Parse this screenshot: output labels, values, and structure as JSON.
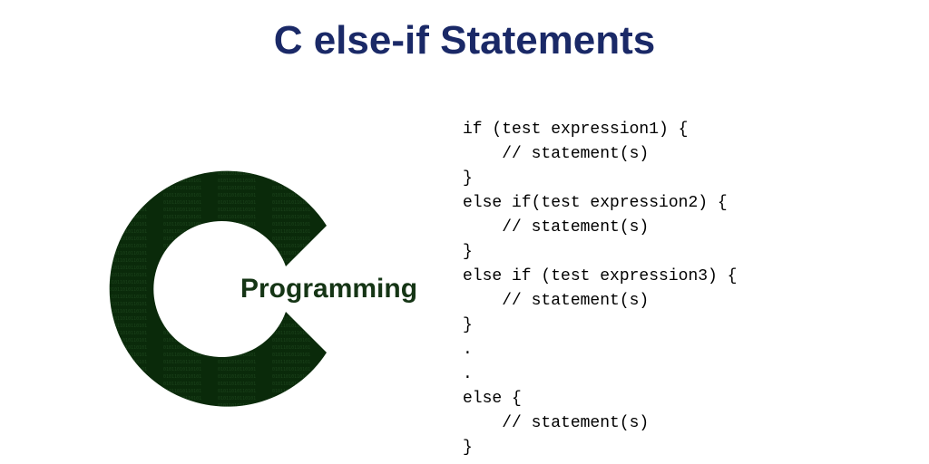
{
  "title": "C else-if Statements",
  "logo_label": "Programming",
  "code_lines": [
    "if (test expression1) {",
    "    // statement(s)",
    "}",
    "else if(test expression2) {",
    "    // statement(s)",
    "}",
    "else if (test expression3) {",
    "    // statement(s)",
    "}",
    ".",
    ".",
    "else {",
    "    // statement(s)",
    "}"
  ],
  "colors": {
    "title": "#1a2967",
    "logo_dark": "#0a2a0a",
    "logo_text": "#153515"
  }
}
